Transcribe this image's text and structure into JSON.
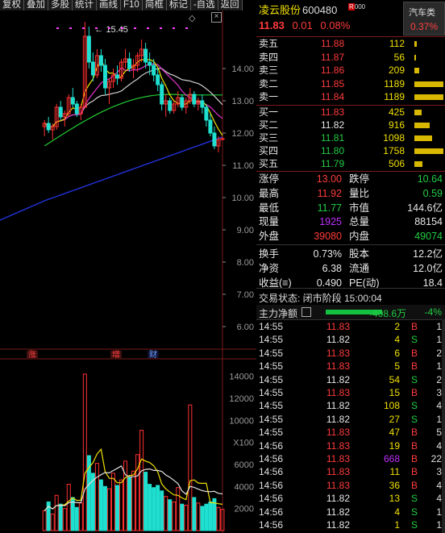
{
  "toolbar": [
    "复权",
    "叠加",
    "多股",
    "统计",
    "画线",
    "F10",
    "简框",
    "标记",
    "-自选",
    "返回"
  ],
  "stock": {
    "name": "凌云股份",
    "code": "600480",
    "badge": "R",
    "price": "11.83",
    "change": "0.01",
    "change_pct": "0.08%",
    "sector": "汽车类",
    "sector_pct": "0.37%"
  },
  "kline": {
    "high_marker": "15.45",
    "y_labels": [
      "14.00",
      "13.00",
      "12.00",
      "11.00",
      "10.00",
      "9.00",
      "8.00",
      "7.00",
      "6.00"
    ],
    "vol_labels": [
      "14000",
      "12000",
      "10000",
      "X100",
      "6000",
      "4000",
      "2000"
    ],
    "markers": [
      "涨",
      "增",
      "财"
    ]
  },
  "chart_data": {
    "type": "line",
    "candles": [
      [
        12.2,
        12.4,
        11.9,
        12.3
      ],
      [
        12.3,
        12.5,
        12.0,
        12.1
      ],
      [
        12.1,
        12.3,
        11.8,
        12.2
      ],
      [
        12.2,
        12.9,
        12.1,
        12.8
      ],
      [
        12.8,
        13.0,
        12.4,
        12.5
      ],
      [
        12.5,
        12.7,
        12.2,
        12.6
      ],
      [
        12.6,
        13.2,
        12.5,
        13.1
      ],
      [
        13.1,
        13.4,
        12.8,
        12.9
      ],
      [
        12.9,
        13.0,
        12.5,
        12.6
      ],
      [
        12.6,
        12.9,
        12.4,
        12.8
      ],
      [
        12.8,
        15.45,
        12.8,
        15.0
      ],
      [
        15.0,
        15.3,
        14.0,
        14.2
      ],
      [
        14.2,
        14.5,
        13.6,
        13.8
      ],
      [
        13.8,
        14.6,
        13.7,
        14.4
      ],
      [
        14.4,
        14.6,
        13.9,
        14.1
      ],
      [
        14.1,
        14.3,
        13.2,
        13.4
      ],
      [
        13.4,
        13.7,
        12.9,
        13.6
      ],
      [
        13.6,
        14.0,
        13.4,
        13.8
      ],
      [
        13.8,
        14.1,
        13.5,
        13.7
      ],
      [
        13.7,
        14.3,
        13.6,
        14.2
      ],
      [
        14.2,
        14.6,
        14.0,
        14.3
      ],
      [
        14.3,
        14.5,
        13.9,
        14.0
      ],
      [
        14.0,
        14.3,
        13.7,
        14.1
      ],
      [
        14.1,
        14.5,
        13.9,
        14.4
      ],
      [
        14.4,
        14.9,
        14.2,
        14.6
      ],
      [
        14.6,
        14.8,
        14.0,
        14.2
      ],
      [
        14.2,
        14.5,
        13.8,
        14.1
      ],
      [
        14.1,
        14.3,
        13.6,
        13.8
      ],
      [
        13.8,
        14.0,
        13.3,
        13.5
      ],
      [
        13.5,
        13.6,
        12.7,
        12.9
      ],
      [
        12.9,
        13.2,
        12.5,
        13.0
      ],
      [
        13.0,
        13.1,
        12.6,
        12.7
      ],
      [
        12.7,
        13.0,
        12.6,
        12.9
      ],
      [
        12.9,
        13.3,
        12.8,
        13.1
      ],
      [
        13.1,
        13.2,
        12.7,
        12.8
      ],
      [
        12.8,
        13.1,
        12.6,
        13.0
      ],
      [
        13.0,
        13.4,
        12.9,
        13.2
      ],
      [
        13.2,
        13.3,
        12.8,
        12.9
      ],
      [
        12.9,
        13.1,
        12.7,
        13.0
      ],
      [
        13.0,
        13.2,
        12.6,
        12.8
      ],
      [
        12.8,
        12.9,
        12.2,
        12.4
      ],
      [
        12.4,
        12.6,
        11.9,
        12.0
      ],
      [
        12.0,
        12.2,
        11.5,
        11.6
      ],
      [
        11.6,
        11.9,
        11.4,
        11.8
      ],
      [
        11.8,
        11.9,
        11.77,
        11.83
      ]
    ],
    "volumes": [
      1800,
      2600,
      1500,
      3200,
      2400,
      2000,
      4200,
      3000,
      2100,
      2500,
      14200,
      6800,
      5200,
      6100,
      4600,
      4000,
      3800,
      5200,
      4100,
      4600,
      6300,
      4800,
      5400,
      6900,
      9100,
      5300,
      4200,
      3900,
      4100,
      3600,
      3100,
      2800,
      2600,
      3900,
      2400,
      2300,
      11400,
      3000,
      2500,
      2200,
      2400,
      2600,
      2900,
      2100,
      1925
    ],
    "y_range": [
      5.8,
      15.8
    ],
    "vol_range": [
      0,
      15000
    ]
  },
  "book": {
    "asks": [
      {
        "label": "卖五",
        "price": "11.88",
        "vol": "112"
      },
      {
        "label": "卖四",
        "price": "11.87",
        "vol": "56"
      },
      {
        "label": "卖三",
        "price": "11.86",
        "vol": "209"
      },
      {
        "label": "卖二",
        "price": "11.85",
        "vol": "1189"
      },
      {
        "label": "卖一",
        "price": "11.84",
        "vol": "1189"
      }
    ],
    "bids": [
      {
        "label": "买一",
        "price": "11.83",
        "vol": "425",
        "color": "red"
      },
      {
        "label": "买二",
        "price": "11.82",
        "vol": "916",
        "color": "white"
      },
      {
        "label": "买三",
        "price": "11.81",
        "vol": "1098",
        "color": "green"
      },
      {
        "label": "买四",
        "price": "11.80",
        "vol": "1758",
        "color": "green"
      },
      {
        "label": "买五",
        "price": "11.79",
        "vol": "506",
        "color": "green"
      }
    ]
  },
  "stats": [
    {
      "l1": "涨停",
      "v1": "13.00",
      "c1": "red",
      "l2": "跌停",
      "v2": "10.64",
      "c2": "green"
    },
    {
      "l1": "最高",
      "v1": "11.92",
      "c1": "red",
      "l2": "量比",
      "v2": "0.59",
      "c2": "green"
    },
    {
      "l1": "最低",
      "v1": "11.77",
      "c1": "green",
      "l2": "市值",
      "v2": "144.6亿",
      "c2": "white"
    },
    {
      "l1": "现量",
      "v1": "1925",
      "c1": "purple",
      "l2": "总量",
      "v2": "88154",
      "c2": "white"
    },
    {
      "l1": "外盘",
      "v1": "39080",
      "c1": "red",
      "l2": "内盘",
      "v2": "49074",
      "c2": "green"
    },
    {
      "l1": "换手",
      "v1": "0.73%",
      "c1": "white",
      "l2": "股本",
      "v2": "12.2亿",
      "c2": "white"
    },
    {
      "l1": "净资",
      "v1": "6.38",
      "c1": "white",
      "l2": "流通",
      "v2": "12.0亿",
      "c2": "white"
    },
    {
      "l1": "收益(≡)",
      "v1": "0.490",
      "c1": "white",
      "l2": "PE(动)",
      "v2": "18.4",
      "c2": "white"
    }
  ],
  "status": "交易状态: 闭市阶段 15:00:04",
  "netflow": {
    "label": "主力净额",
    "value": "-408.6万",
    "pct": "-4%"
  },
  "trades": [
    {
      "t": "14:55",
      "p": "11.83",
      "pc": "red",
      "v": "2",
      "vc": "yellow",
      "d": "B",
      "n": "1"
    },
    {
      "t": "14:55",
      "p": "11.82",
      "pc": "white",
      "v": "4",
      "vc": "yellow",
      "d": "S",
      "n": "1"
    },
    {
      "t": "14:55",
      "p": "11.83",
      "pc": "red",
      "v": "6",
      "vc": "yellow",
      "d": "B",
      "n": "2"
    },
    {
      "t": "14:55",
      "p": "11.83",
      "pc": "red",
      "v": "5",
      "vc": "yellow",
      "d": "B",
      "n": "1"
    },
    {
      "t": "14:55",
      "p": "11.82",
      "pc": "white",
      "v": "54",
      "vc": "yellow",
      "d": "S",
      "n": "2"
    },
    {
      "t": "14:55",
      "p": "11.83",
      "pc": "red",
      "v": "15",
      "vc": "yellow",
      "d": "B",
      "n": "3"
    },
    {
      "t": "14:55",
      "p": "11.82",
      "pc": "white",
      "v": "108",
      "vc": "yellow",
      "d": "S",
      "n": "4"
    },
    {
      "t": "14:55",
      "p": "11.82",
      "pc": "white",
      "v": "27",
      "vc": "yellow",
      "d": "S",
      "n": "1"
    },
    {
      "t": "14:55",
      "p": "11.83",
      "pc": "red",
      "v": "47",
      "vc": "yellow",
      "d": "B",
      "n": "5"
    },
    {
      "t": "14:56",
      "p": "11.83",
      "pc": "red",
      "v": "19",
      "vc": "yellow",
      "d": "B",
      "n": "4"
    },
    {
      "t": "14:56",
      "p": "11.83",
      "pc": "red",
      "v": "668",
      "vc": "purple",
      "d": "B",
      "n": "22"
    },
    {
      "t": "14:56",
      "p": "11.83",
      "pc": "red",
      "v": "11",
      "vc": "yellow",
      "d": "B",
      "n": "3"
    },
    {
      "t": "14:56",
      "p": "11.83",
      "pc": "red",
      "v": "36",
      "vc": "yellow",
      "d": "B",
      "n": "4"
    },
    {
      "t": "14:56",
      "p": "11.82",
      "pc": "white",
      "v": "13",
      "vc": "yellow",
      "d": "S",
      "n": "4"
    },
    {
      "t": "14:56",
      "p": "11.82",
      "pc": "white",
      "v": "4",
      "vc": "yellow",
      "d": "S",
      "n": "1"
    },
    {
      "t": "14:56",
      "p": "11.82",
      "pc": "white",
      "v": "1",
      "vc": "yellow",
      "d": "S",
      "n": "1"
    }
  ]
}
